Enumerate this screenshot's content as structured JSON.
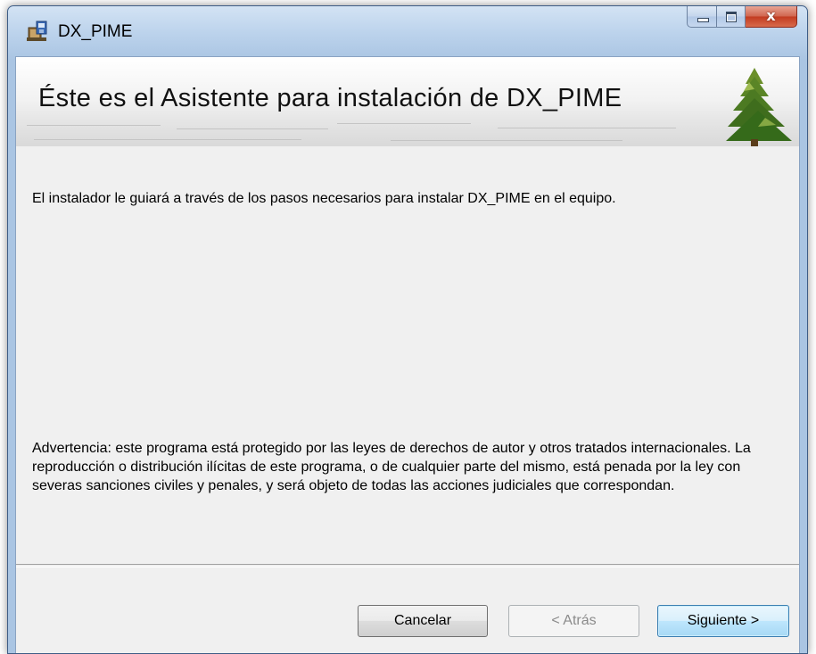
{
  "window": {
    "title": "DX_PIME",
    "close_glyph": "x",
    "icons": {
      "app": "installer-package-icon",
      "minimize": "minimize-icon",
      "maximize": "maximize-icon",
      "close": "close-icon",
      "logo": "pine-tree-logo-icon"
    }
  },
  "banner": {
    "title": "Éste es el Asistente para instalación de DX_PIME"
  },
  "content": {
    "intro": "El instalador le guiará a través de los pasos necesarios para instalar DX_PIME en el equipo.",
    "warning": "Advertencia: este programa está protegido por las leyes de derechos de autor y otros tratados internacionales. La reproducción o distribución ilícitas de este programa, o de cualquier parte del mismo, está penada por la ley con severas sanciones civiles y penales, y será objeto de todas las acciones judiciales que correspondan."
  },
  "buttons": {
    "cancel": "Cancelar",
    "back": "< Atrás",
    "next": "Siguiente >"
  },
  "colors": {
    "banner_green": "#2f7b32",
    "default_button_border": "#3c7fb1",
    "window_frame": "#aac5e3"
  }
}
